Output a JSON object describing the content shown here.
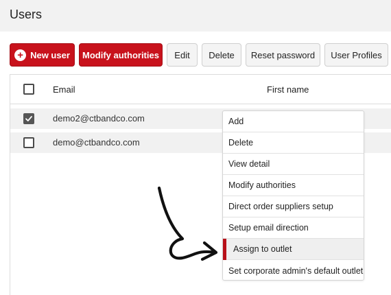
{
  "page": {
    "title": "Users"
  },
  "toolbar": {
    "new_user": "New user",
    "new_user_icon": "plus-circle-icon",
    "modify_authorities": "Modify authorities",
    "edit": "Edit",
    "delete": "Delete",
    "reset_password": "Reset password",
    "user_profiles": "User Profiles"
  },
  "table": {
    "headers": {
      "email": "Email",
      "first_name": "First name"
    },
    "rows": [
      {
        "email": "demo2@ctbandco.com",
        "checked": true
      },
      {
        "email": "demo@ctbandco.com",
        "checked": false
      }
    ]
  },
  "context_menu": {
    "items": [
      "Add",
      "Delete",
      "View detail",
      "Modify authorities",
      "Direct order suppliers setup",
      "Setup email direction",
      "Assign to outlet",
      "Set corporate admin's default outlet"
    ],
    "highlighted_index": 6
  },
  "colors": {
    "primary": "#c8121c",
    "highlight_bar": "#b8111a",
    "header_bg": "#f2f2f2",
    "row_bg": "#f1f1f1"
  },
  "annotation": {
    "icon": "hand-drawn-arrow-icon"
  }
}
